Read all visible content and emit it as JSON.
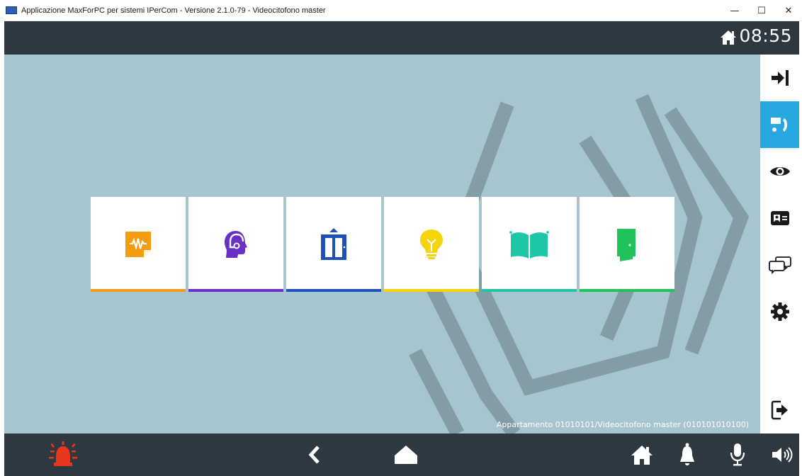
{
  "window": {
    "title": "Applicazione MaxForPC per sistemi IPerCom - Versione 2.1.0-79 - Videocitofono master",
    "minimize": "—",
    "maximize": "☐",
    "close": "✕"
  },
  "header": {
    "icon": "home-icon",
    "clock": "08:55"
  },
  "tiles": [
    {
      "icon": "audio-message-icon",
      "color": "#f39c12",
      "bar_color": "#f39c12"
    },
    {
      "icon": "headset-operator-icon",
      "color": "#6a2fc4",
      "bar_color": "#6a2fc4"
    },
    {
      "icon": "elevator-icon",
      "color": "#1f4fb8",
      "bar_color": "#1f4fb8"
    },
    {
      "icon": "lightbulb-icon",
      "color": "#f5d40c",
      "bar_color": "#f5d40c"
    },
    {
      "icon": "gate-icon",
      "color": "#1ec6a8",
      "bar_color": "#1ec6a8"
    },
    {
      "icon": "door-icon",
      "color": "#22c25a",
      "bar_color": "#22c25a"
    }
  ],
  "footer": {
    "device_text": "Appartamento 01010101/Videocitofono master (010101010100)"
  },
  "sidebar": {
    "items": [
      {
        "icon": "arrow-to-bar-icon"
      },
      {
        "icon": "intercom-call-icon",
        "active": true
      },
      {
        "icon": "eye-icon"
      },
      {
        "icon": "contact-card-icon"
      },
      {
        "icon": "chat-bubbles-icon"
      },
      {
        "icon": "gear-icon"
      },
      {
        "icon": "logout-icon"
      }
    ],
    "active_color": "#27a8e0"
  },
  "bottombar": {
    "items": [
      "alarm-icon",
      "back-chevron-icon",
      "home-shape-icon",
      "home-icon",
      "bell-icon",
      "microphone-icon",
      "speaker-icon"
    ],
    "alarm_color": "#e8361f"
  },
  "colors": {
    "background": "#a7c5cf",
    "bars": "#2e3840",
    "deco": "#7f959e"
  }
}
